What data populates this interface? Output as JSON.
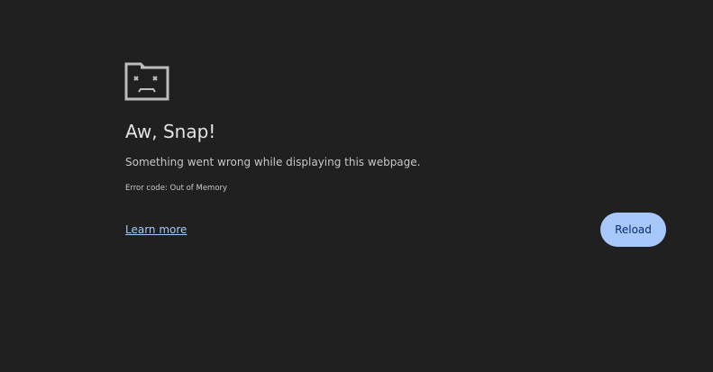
{
  "error_page": {
    "icon": "sad-folder-icon",
    "title": "Aw, Snap!",
    "message": "Something went wrong while displaying this webpage.",
    "error_code": "Error code: Out of Memory",
    "learn_more_label": "Learn more",
    "reload_label": "Reload"
  },
  "colors": {
    "background": "#202020",
    "title_text": "#e3e3e3",
    "body_text": "#c7c7c7",
    "link": "#a8c7fa",
    "button_bg": "#a8c7fa",
    "button_text": "#062e6f",
    "icon_stroke": "#bdbdbd"
  }
}
